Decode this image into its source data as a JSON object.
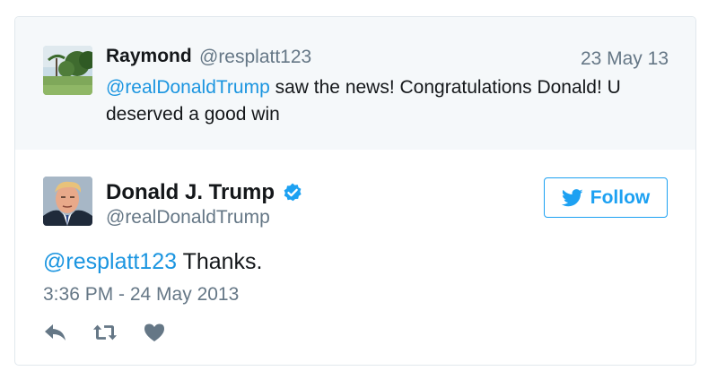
{
  "parent_tweet": {
    "name": "Raymond",
    "handle": "@resplatt123",
    "date": "23 May 13",
    "mention": "@realDonaldTrump",
    "text": " saw the news! Congratulations Donald! U deserved a good win",
    "avatar_icon": "landscape-avatar"
  },
  "main_tweet": {
    "name": "Donald J. Trump",
    "handle": "@realDonaldTrump",
    "verified_icon": "verified-badge-icon",
    "follow_label": "Follow",
    "mention": "@resplatt123",
    "text": " Thanks.",
    "timestamp": "3:36 PM - 24 May 2013",
    "avatar_icon": "portrait-avatar"
  },
  "actions": [
    {
      "name": "reply",
      "icon": "reply-icon"
    },
    {
      "name": "retweet",
      "icon": "retweet-icon"
    },
    {
      "name": "like",
      "icon": "heart-icon"
    }
  ],
  "colors": {
    "link": "#1b95e0",
    "brand": "#1da1f2",
    "muted": "#657786",
    "text": "#14171a",
    "parent_bg": "#f5f8fa",
    "border": "#e1e8ed",
    "icon": "#657786"
  }
}
